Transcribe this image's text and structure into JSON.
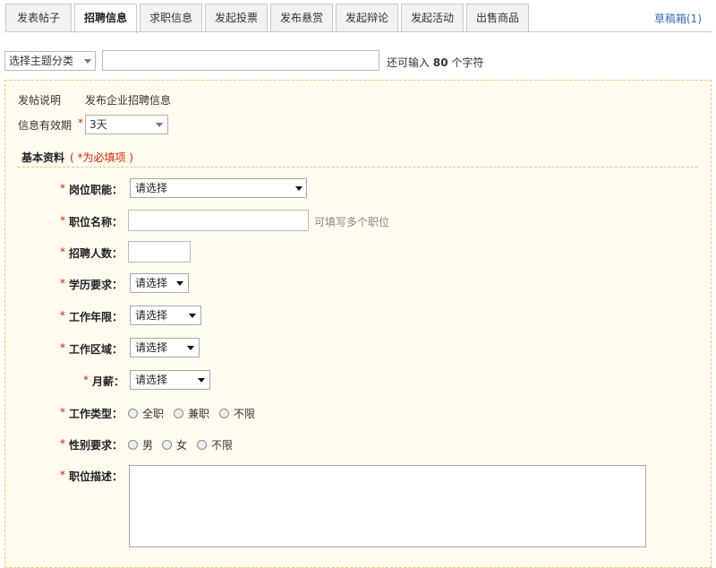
{
  "tabs": [
    {
      "label": "发表帖子"
    },
    {
      "label": "招聘信息"
    },
    {
      "label": "求职信息"
    },
    {
      "label": "发起投票"
    },
    {
      "label": "发布悬赏"
    },
    {
      "label": "发起辩论"
    },
    {
      "label": "发起活动"
    },
    {
      "label": "出售商品"
    }
  ],
  "active_tab": "招聘信息",
  "draft_link": "草稿箱(1)",
  "title_row": {
    "category_select": "选择主题分类",
    "title_value": "",
    "hint_prefix": "还可输入",
    "hint_count": "80",
    "hint_suffix": "个字符"
  },
  "post_info": {
    "label": "发帖说明",
    "text": "发布企业招聘信息"
  },
  "validity": {
    "label": "信息有效期",
    "required_mark": "*",
    "value": "3天"
  },
  "section": {
    "title": "基本资料",
    "note": "( *为必填项 )"
  },
  "fields": {
    "position_function": {
      "label": "岗位职能：",
      "value": "请选择"
    },
    "position_name": {
      "label": "职位名称：",
      "value": "",
      "note": "可填写多个职位"
    },
    "headcount": {
      "label": "招聘人数：",
      "value": ""
    },
    "education": {
      "label": "学历要求：",
      "value": "请选择"
    },
    "experience": {
      "label": "工作年限：",
      "value": "请选择"
    },
    "work_area": {
      "label": "工作区域：",
      "value": "请选择"
    },
    "salary": {
      "label": "月薪：",
      "value": "请选择"
    },
    "job_type": {
      "label": "工作类型：",
      "options": [
        "全职",
        "兼职",
        "不限"
      ]
    },
    "gender": {
      "label": "性别要求：",
      "options": [
        "男",
        "女",
        "不限"
      ]
    },
    "description": {
      "label": "职位描述：",
      "value": ""
    }
  },
  "required_mark": "*",
  "colors": {
    "panel_bg": "#fffbef",
    "panel_border": "#f0c870",
    "required": "#d81e06",
    "link": "#3a6fb0"
  }
}
